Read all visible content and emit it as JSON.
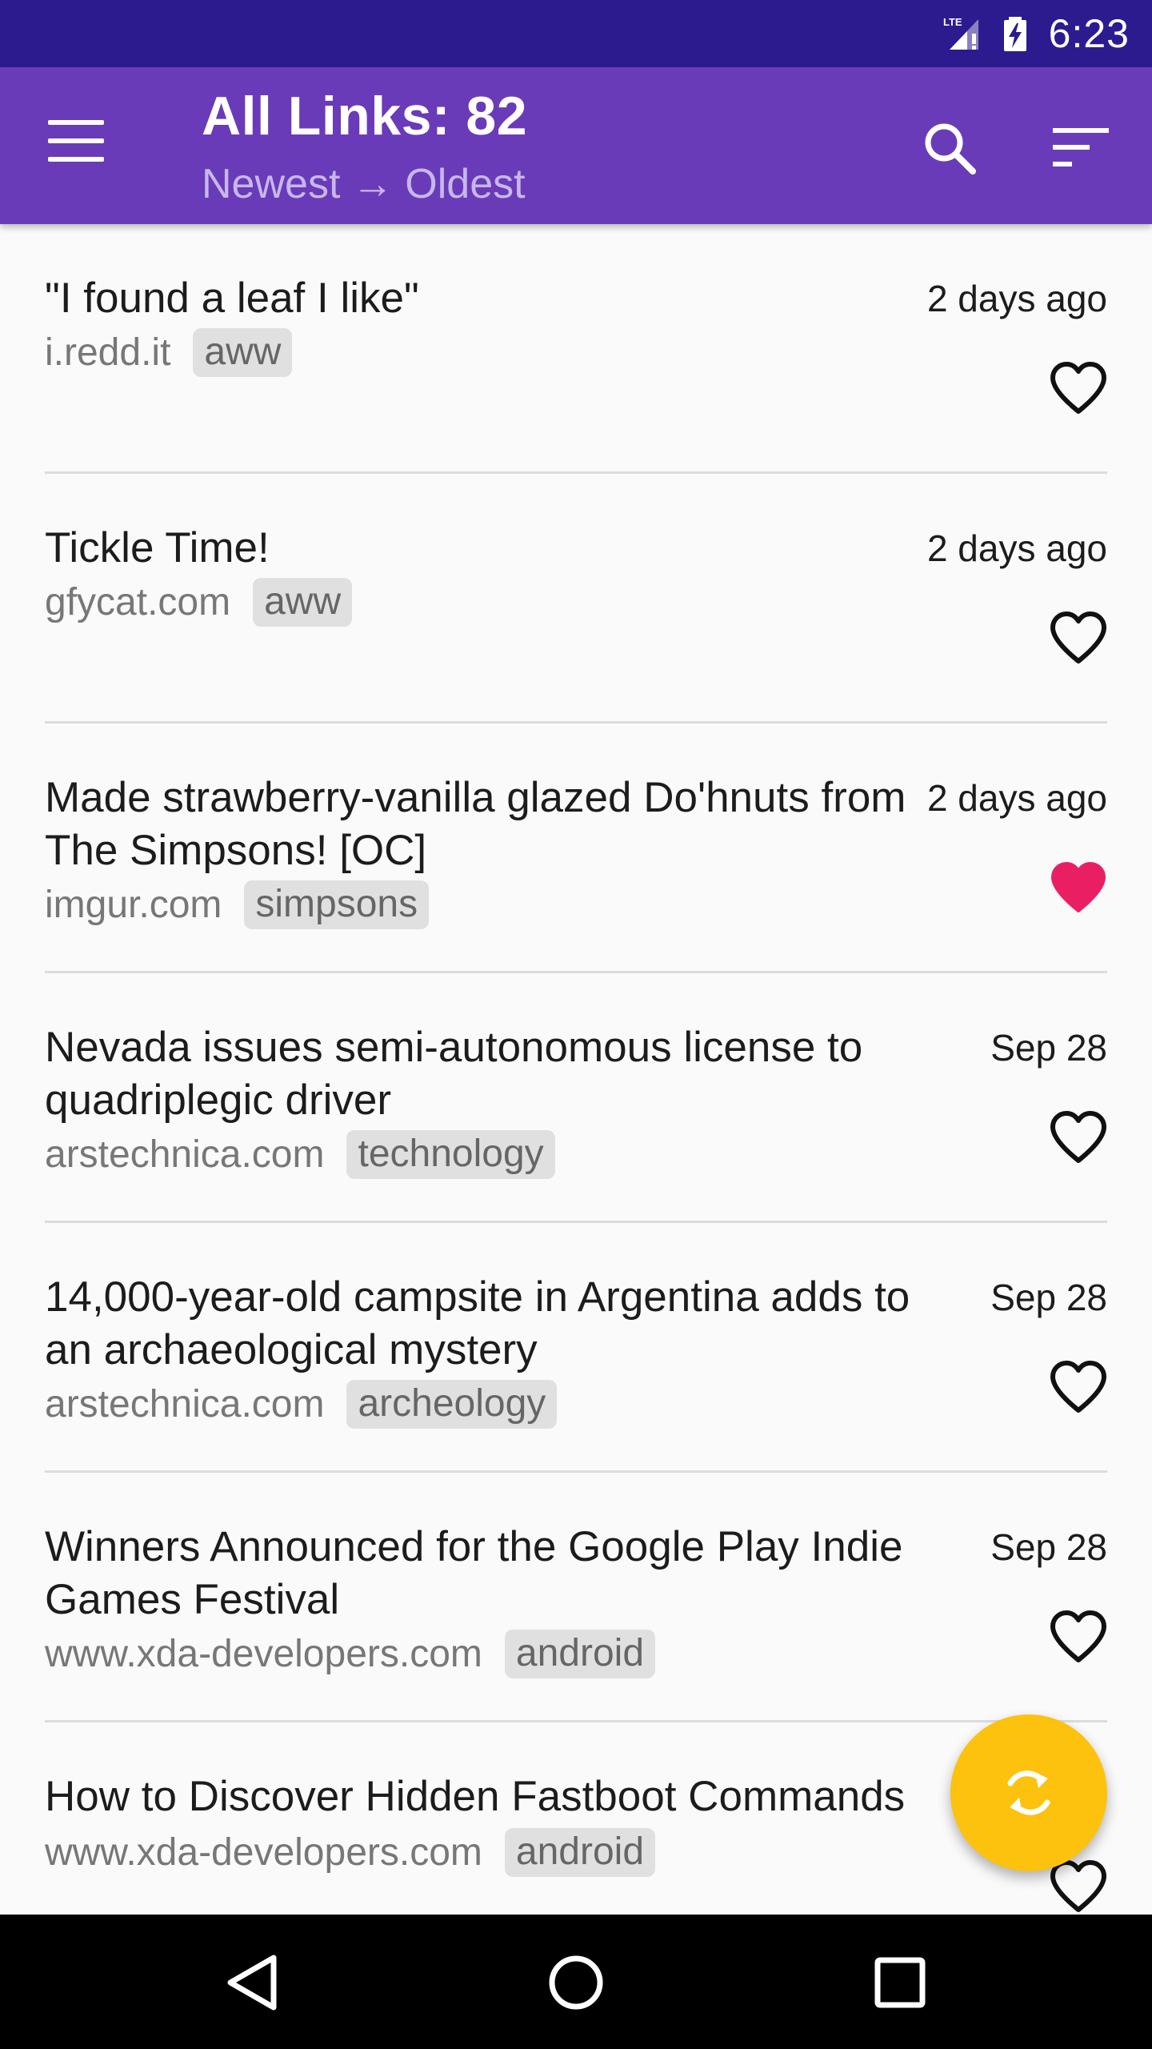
{
  "status_bar": {
    "time": "6:23",
    "icons": [
      "lte-signal-icon",
      "battery-charging-icon"
    ],
    "network_label": "LTE"
  },
  "app_bar": {
    "title": "All Links: 82",
    "subtitle": "Newest → Oldest",
    "icons": [
      "menu-icon",
      "search-icon",
      "sort-icon"
    ],
    "background_color": "#6a3bb8"
  },
  "links": [
    {
      "title": "\"I found a leaf I like\"",
      "date": "2 days ago",
      "domain": "i.redd.it",
      "tag": "aww",
      "favorited": false
    },
    {
      "title": "Tickle Time!",
      "date": "2 days ago",
      "domain": "gfycat.com",
      "tag": "aww",
      "favorited": false
    },
    {
      "title": "Made strawberry-vanilla glazed Do'hnuts from The Simpsons! [OC]",
      "date": "2 days ago",
      "domain": "imgur.com",
      "tag": "simpsons",
      "favorited": true
    },
    {
      "title": "Nevada issues semi-autonomous license to quadriplegic driver",
      "date": "Sep 28",
      "domain": "arstechnica.com",
      "tag": "technology",
      "favorited": false
    },
    {
      "title": "14,000-year-old campsite in Argentina adds to an archaeological mystery",
      "date": "Sep 28",
      "domain": "arstechnica.com",
      "tag": "archeology",
      "favorited": false
    },
    {
      "title": "Winners Announced for the Google Play Indie Games Festival",
      "date": "Sep 28",
      "domain": "www.xda-developers.com",
      "tag": "android",
      "favorited": false
    },
    {
      "title": "How to Discover Hidden Fastboot Commands",
      "date": "",
      "domain": "www.xda-developers.com",
      "tag": "android",
      "favorited": false
    }
  ],
  "fab": {
    "icon": "refresh-icon",
    "color": "#fdc20e"
  },
  "heart_color_active": "#ea1f63",
  "nav_bar": {
    "icons": [
      "back-icon",
      "home-icon",
      "recents-icon"
    ]
  }
}
